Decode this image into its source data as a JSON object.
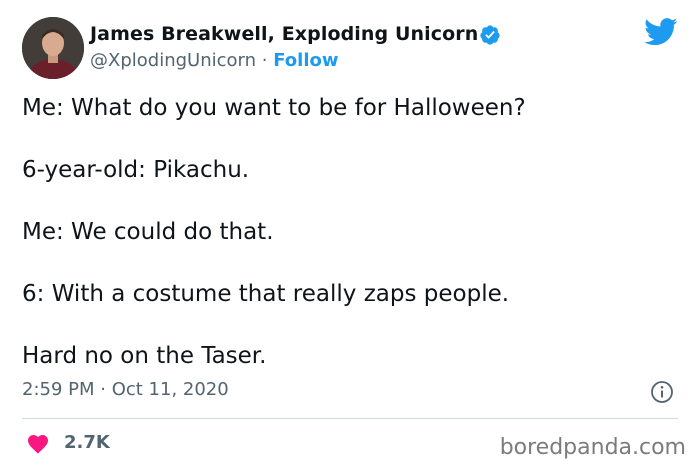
{
  "author": {
    "name": "James Breakwell, Exploding Unicorn",
    "handle": "@XplodingUnicorn",
    "separator": "·",
    "follow_label": "Follow"
  },
  "tweet": {
    "lines": [
      "Me: What do you want to be for Halloween?",
      "6-year-old: Pikachu.",
      "Me: We could do that.",
      "6: With a costume that really zaps people.",
      "Hard no on the Taser."
    ],
    "timestamp": "2:59 PM · Oct 11, 2020"
  },
  "engagement": {
    "likes": "2.7K"
  },
  "watermark": "boredpanda.com",
  "colors": {
    "accent": "#1d9bf0",
    "like": "#f91880",
    "muted": "#536471",
    "text": "#0f1419"
  },
  "icons": [
    "avatar",
    "verified-badge-icon",
    "twitter-bird-icon",
    "info-icon",
    "heart-icon"
  ]
}
